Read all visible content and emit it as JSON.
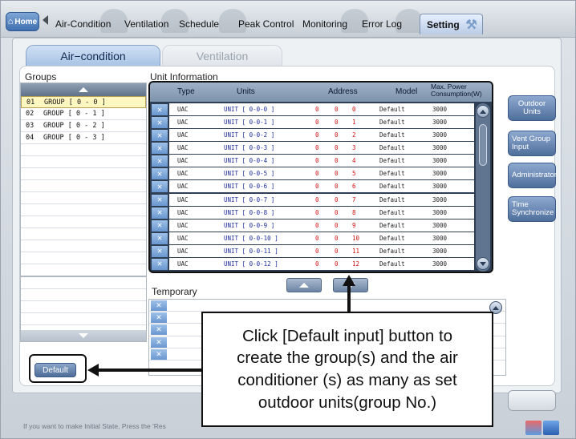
{
  "nav": {
    "home": "Home",
    "tabs": [
      "Air-Condition",
      "Ventilation",
      "Schedule",
      "Peak Control",
      "Monitoring",
      "Error Log",
      "Setting"
    ],
    "active_tab": "Setting"
  },
  "subtabs": {
    "aircon": "Air−condition",
    "vent": "Ventilation"
  },
  "groups": {
    "label": "Groups",
    "items": [
      {
        "no": "01",
        "name": "GROUP [ 0 - 0 ]"
      },
      {
        "no": "02",
        "name": "GROUP [ 0 - 1 ]"
      },
      {
        "no": "03",
        "name": "GROUP [ 0 - 2 ]"
      },
      {
        "no": "04",
        "name": "GROUP [ 0 - 3 ]"
      }
    ],
    "default_button": "Default"
  },
  "unit_info": {
    "label": "Unit Information",
    "headers": {
      "type": "Type",
      "units": "Units",
      "address": "Address",
      "model": "Model",
      "power_1": "Max. Power",
      "power_2": "Consumption(W)"
    },
    "rows": [
      {
        "type": "UAC",
        "unit": "UNIT [ 0-0-0 ]",
        "a1": "0",
        "a2": "0",
        "a3": "0",
        "model": "Default",
        "power": "3000"
      },
      {
        "type": "UAC",
        "unit": "UNIT [ 0-0-1 ]",
        "a1": "0",
        "a2": "0",
        "a3": "1",
        "model": "Default",
        "power": "3000"
      },
      {
        "type": "UAC",
        "unit": "UNIT [ 0-0-2 ]",
        "a1": "0",
        "a2": "0",
        "a3": "2",
        "model": "Default",
        "power": "3000"
      },
      {
        "type": "UAC",
        "unit": "UNIT [ 0-0-3 ]",
        "a1": "0",
        "a2": "0",
        "a3": "3",
        "model": "Default",
        "power": "3000"
      },
      {
        "type": "UAC",
        "unit": "UNIT [ 0-0-4 ]",
        "a1": "0",
        "a2": "0",
        "a3": "4",
        "model": "Default",
        "power": "3000"
      },
      {
        "type": "UAC",
        "unit": "UNIT [ 0-0-5 ]",
        "a1": "0",
        "a2": "0",
        "a3": "5",
        "model": "Default",
        "power": "3000"
      },
      {
        "type": "UAC",
        "unit": "UNIT [ 0-0-6 ]",
        "a1": "0",
        "a2": "0",
        "a3": "6",
        "model": "Default",
        "power": "3000"
      },
      {
        "type": "UAC",
        "unit": "UNIT [ 0-0-7 ]",
        "a1": "0",
        "a2": "0",
        "a3": "7",
        "model": "Default",
        "power": "3000"
      },
      {
        "type": "UAC",
        "unit": "UNIT [ 0-0-8 ]",
        "a1": "0",
        "a2": "0",
        "a3": "8",
        "model": "Default",
        "power": "3000"
      },
      {
        "type": "UAC",
        "unit": "UNIT [ 0-0-9 ]",
        "a1": "0",
        "a2": "0",
        "a3": "9",
        "model": "Default",
        "power": "3000"
      },
      {
        "type": "UAC",
        "unit": "UNIT [ 0-0-10 ]",
        "a1": "0",
        "a2": "0",
        "a3": "10",
        "model": "Default",
        "power": "3000"
      },
      {
        "type": "UAC",
        "unit": "UNIT [ 0-0-11 ]",
        "a1": "0",
        "a2": "0",
        "a3": "11",
        "model": "Default",
        "power": "3000"
      },
      {
        "type": "UAC",
        "unit": "UNIT [ 0-0-12 ]",
        "a1": "0",
        "a2": "0",
        "a3": "12",
        "model": "Default",
        "power": "3000"
      }
    ]
  },
  "side_buttons": {
    "outdoor_units": "Outdoor Units",
    "vent_group_input": "Vent Group Input",
    "administrator": "Administrator",
    "time_synchronize": "Time Synchronize"
  },
  "temporary": {
    "label": "Temporary"
  },
  "callout": {
    "line1": "Click [Default input] button to",
    "line2": "create the  group(s) and the air",
    "line3": "conditioner (s) as many as set",
    "line4": "outdoor units(group No.)"
  },
  "status": {
    "text": "If you want to make Initial State, Press the 'Res"
  },
  "colors": {
    "accent": "#4f6f9c",
    "selected_row": "#fff7c0",
    "address_red": "#d01010",
    "unit_blue": "#1b2b9c"
  }
}
